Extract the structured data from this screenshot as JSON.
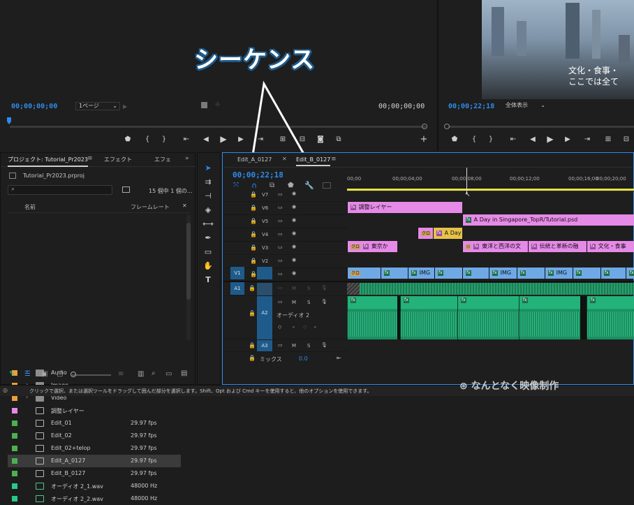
{
  "source_monitor": {
    "timecode_left": "00;00;00;00",
    "page_select": "1ページ",
    "timecode_right": "00;00;00;00"
  },
  "program_monitor": {
    "timecode": "00;00;22;18",
    "fit_select": "全体表示",
    "caption_line1": "文化・食事・",
    "caption_line2": "ここでは全て"
  },
  "annotation": {
    "label": "シーケンス"
  },
  "project_panel": {
    "tabs": [
      "プロジェクト: Tutorial_Pr2023",
      "エフェクト",
      "エフェ"
    ],
    "project_file": "Tutorial_Pr2023.prproj",
    "item_count": "15 個中 1 個の...",
    "col_name": "名前",
    "col_framerate": "フレームレート",
    "items": [
      {
        "name": "Audio",
        "fps": "",
        "color": "#e8a13a",
        "kind": "folder"
      },
      {
        "name": "Image",
        "fps": "",
        "color": "#e8a13a",
        "kind": "folder"
      },
      {
        "name": "Video",
        "fps": "",
        "color": "#e8a13a",
        "kind": "folder"
      },
      {
        "name": "調整レイヤー",
        "fps": "",
        "color": "#e68ae8",
        "kind": "layer"
      },
      {
        "name": "Edit_01",
        "fps": "29.97 fps",
        "color": "#4caf50",
        "kind": "seq"
      },
      {
        "name": "Edit_02",
        "fps": "29.97 fps",
        "color": "#4caf50",
        "kind": "seq"
      },
      {
        "name": "Edit_02+telop",
        "fps": "29.97 fps",
        "color": "#4caf50",
        "kind": "seq"
      },
      {
        "name": "Edit_A_0127",
        "fps": "29.97 fps",
        "color": "#4caf50",
        "kind": "seq"
      },
      {
        "name": "Edit_B_0127",
        "fps": "29.97 fps",
        "color": "#4caf50",
        "kind": "seq"
      },
      {
        "name": "オーディオ 2_1.wav",
        "fps": "48000 Hz",
        "color": "#27c98a",
        "kind": "audio"
      },
      {
        "name": "オーディオ 2_2.wav",
        "fps": "48000 Hz",
        "color": "#27c98a",
        "kind": "audio"
      }
    ]
  },
  "timeline": {
    "tabs": [
      "Edit_A_0127",
      "Edit_B_0127"
    ],
    "timecode": "00;00;22;18",
    "ruler_labels": [
      "00;00",
      "00;00;04;00",
      "00;00;08;00",
      "00;00;12;00",
      "00;00;16;00",
      "00;00;20;00"
    ],
    "video_tracks": [
      "V7",
      "V6",
      "V5",
      "V4",
      "V3",
      "V2",
      "V1"
    ],
    "audio_tracks": [
      "A1",
      "A2",
      "A3"
    ],
    "source_patch_video": "V1",
    "source_patch_audio": "A1",
    "audio2_name": "オーディオ 2",
    "mix_label": "ミックス",
    "mix_value": "0.0",
    "mute_label": "M",
    "solo_label": "S",
    "clips": {
      "v6": "調整レイヤー",
      "v5": "A Day in Singapore_TopR/Tutorial.psd",
      "v4": "A Day",
      "v3_badge": "クロ",
      "v3_a": "東京か",
      "v3_b": "東洋と西洋の文",
      "v3_c": "伝統と革新の融",
      "v3_d": "文化・食事",
      "v1_badge": "クロ",
      "v1_img": "IMG"
    }
  },
  "status_bar": {
    "message": "クリックで選択、または選択ツールをドラッグして囲んだ部分を選択します。Shift、Opt および Cmd キーを使用すると、他のオプションを使用できます。"
  },
  "watermark": {
    "text": "なんとなく映像制作"
  }
}
